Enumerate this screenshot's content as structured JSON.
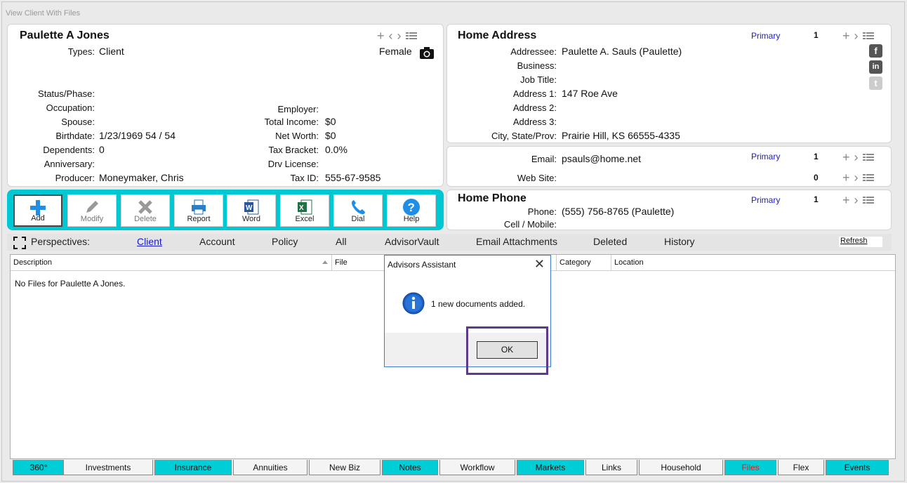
{
  "window": {
    "title": "View Client With Files"
  },
  "client": {
    "name": "Paulette A Jones",
    "types_label": "Types:",
    "types": "Client",
    "gender": "Female",
    "left_fields": [
      {
        "label": "Status/Phase:",
        "value": ""
      },
      {
        "label": "Occupation:",
        "value": ""
      },
      {
        "label": "Spouse:",
        "value": ""
      },
      {
        "label": "Birthdate:",
        "value": "1/23/1969  54 / 54"
      },
      {
        "label": "Dependents:",
        "value": "0"
      },
      {
        "label": "Anniversary:",
        "value": ""
      },
      {
        "label": "Producer:",
        "value": "Moneymaker, Chris"
      }
    ],
    "right_fields": [
      {
        "label": "Employer:",
        "value": ""
      },
      {
        "label": "Total Income:",
        "value": "$0"
      },
      {
        "label": "Net Worth:",
        "value": "$0"
      },
      {
        "label": "Tax Bracket:",
        "value": "0.0%"
      },
      {
        "label": "Drv License:",
        "value": ""
      },
      {
        "label": "Tax ID:",
        "value": "555-67-9585"
      }
    ]
  },
  "address": {
    "heading": "Home Address",
    "primary": "Primary",
    "count": "1",
    "fields": [
      {
        "label": "Addressee:",
        "value": "Paulette A. Sauls (Paulette)"
      },
      {
        "label": "Business:",
        "value": ""
      },
      {
        "label": "Job Title:",
        "value": ""
      },
      {
        "label": "Address 1:",
        "value": "147 Roe Ave"
      },
      {
        "label": "Address 2:",
        "value": ""
      },
      {
        "label": "Address 3:",
        "value": ""
      },
      {
        "label": "City, State/Prov:",
        "value": "Prairie Hill,   KS   66555-4335"
      }
    ],
    "social": [
      "f",
      "in",
      "t"
    ]
  },
  "contact": {
    "email_label": "Email:",
    "email": "psauls@home.net",
    "email_primary": "Primary",
    "email_count": "1",
    "web_label": "Web Site:",
    "web": "",
    "web_count": "0"
  },
  "phone": {
    "heading": "Home Phone",
    "primary": "Primary",
    "count": "1",
    "phone_label": "Phone:",
    "phone": "(555) 756-8765  (Paulette)",
    "cell_label": "Cell / Mobile:",
    "cell": ""
  },
  "toolbar": {
    "buttons": [
      {
        "label": "Add",
        "icon": "plus-icon"
      },
      {
        "label": "Modify",
        "icon": "pencil-icon"
      },
      {
        "label": "Delete",
        "icon": "x-icon"
      },
      {
        "label": "Report",
        "icon": "printer-icon"
      },
      {
        "label": "Word",
        "icon": "word-icon"
      },
      {
        "label": "Excel",
        "icon": "excel-icon"
      },
      {
        "label": "Dial",
        "icon": "phone-icon"
      },
      {
        "label": "Help",
        "icon": "help-icon"
      }
    ]
  },
  "perspectives": {
    "label": "Perspectives:",
    "items": [
      "Client",
      "Account",
      "Policy",
      "All",
      "AdvisorVault",
      "Email Attachments",
      "Deleted",
      "History"
    ],
    "refresh": "Refresh"
  },
  "grid": {
    "columns": [
      "Description",
      "File",
      "Category",
      "Location"
    ],
    "empty_text": "No Files for Paulette A Jones."
  },
  "dialog": {
    "title": "Advisors Assistant",
    "message": "1 new documents added.",
    "ok": "OK"
  },
  "tabs": [
    "360°",
    "Investments",
    "Insurance",
    "Annuities",
    "New Biz",
    "Notes",
    "Workflow",
    "Markets",
    "Links",
    "Household",
    "Files",
    "Flex",
    "Events"
  ],
  "colors": {
    "accent": "#00c8d2",
    "link": "#1a1acc",
    "highlight": "#5e3b8a",
    "active_tab": "#e02020"
  }
}
